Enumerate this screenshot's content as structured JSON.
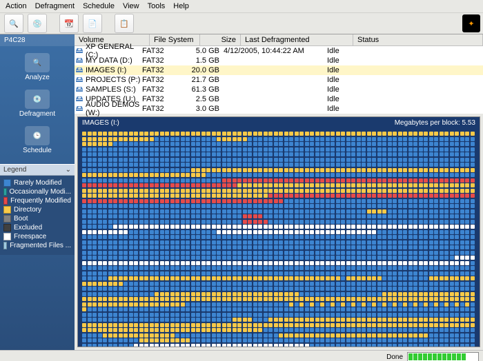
{
  "menu": {
    "items": [
      "Action",
      "Defragment",
      "Schedule",
      "View",
      "Tools",
      "Help"
    ]
  },
  "sidebar": {
    "title": "P4C28",
    "actions": [
      {
        "label": "Analyze"
      },
      {
        "label": "Defragment"
      },
      {
        "label": "Schedule"
      }
    ]
  },
  "legend": {
    "title": "Legend",
    "items": [
      {
        "label": "Rarely Modified",
        "color": "#3d85d1"
      },
      {
        "label": "Occasionally Modi...",
        "color": "#2aa0a0"
      },
      {
        "label": "Frequently Modified",
        "color": "#e54b4b"
      },
      {
        "label": "Directory",
        "color": "#f7c948"
      },
      {
        "label": "Boot",
        "color": "#808080"
      },
      {
        "label": "Excluded",
        "color": "#404040"
      },
      {
        "label": "Freespace",
        "color": "#ffffff"
      },
      {
        "label": "Fragmented Files ...",
        "color": "#9ecae1"
      }
    ]
  },
  "volume_columns": {
    "name": "Volume",
    "fs": "File System",
    "size": "Size",
    "last": "Last Defragmented",
    "status": "Status"
  },
  "volumes": [
    {
      "name": "XP GENERAL (C:)",
      "fs": "FAT32",
      "size": "5.0 GB",
      "last": "4/12/2005, 10:44:22 AM",
      "status": "Idle",
      "sel": false
    },
    {
      "name": "MY DATA (D:)",
      "fs": "FAT32",
      "size": "1.5 GB",
      "last": "",
      "status": "Idle",
      "sel": false
    },
    {
      "name": "IMAGES (I:)",
      "fs": "FAT32",
      "size": "20.0 GB",
      "last": "",
      "status": "Idle",
      "sel": true
    },
    {
      "name": "PROJECTS (P:)",
      "fs": "FAT32",
      "size": "21.7 GB",
      "last": "",
      "status": "Idle",
      "sel": false
    },
    {
      "name": "SAMPLES (S:)",
      "fs": "FAT32",
      "size": "61.3 GB",
      "last": "",
      "status": "Idle",
      "sel": false
    },
    {
      "name": "UPDATES (U:)",
      "fs": "FAT32",
      "size": "2.5 GB",
      "last": "",
      "status": "Idle",
      "sel": false
    },
    {
      "name": "AUDIO DEMOS (W:)",
      "fs": "FAT32",
      "size": "3.0 GB",
      "last": "",
      "status": "Idle",
      "sel": false
    }
  ],
  "map": {
    "title": "IMAGES (I:)",
    "block_info": "Megabytes per block: 5.53",
    "rows": [
      "yyyyyyyyyyyyyyyyyyyyyyyyyyyyyyyyyyyyyyyyyyyyyyyyyyyyyyyyyyyyyyyyyyyyyyyyyyyyyyy",
      "yyyyyyyyyyybbbbbbbbbbbbyyyyyybbbbbbbbbbbbbbbbbbbbbbbbbbbbbbbbbbbbbbbbbbbbyyyyyy",
      "bbbbbbbbbbbbbbbbbbbbbbbbbbbbbbbbbbbbbbbbbbbbbbbbbbbbbbbbbbbbbbbbbbbbbbbbbbbbbbb",
      "bbbbbbbbbbbbbbbbbbbbbbbbbbbbbbbbbbbbbbbbbbbbbbbbbbbbbbbbbbbbbbbbbbbbbbbbbbbbbbb",
      "bbbbbbbbbbbbbbbbbbbbbbbbbbbbbbbbbbbbbbbbbbbbbbbbbbbbbbbbbbbbbbbbbbbbbbbbbbbbbbb",
      "bbbbbbbbbbbbbbbbbbbbbbbbbbbbbbbbbbbbbbbbbbbbbbbbbbbbbbbbbbbbbbbbbbbbbbbbbbbbbbb",
      "bbbbbbbbbbbbbbbbbbbbbbbbbbbbbbbbbbbbbbbbbbbbbbbbbbbbbbbbbbbbbbbbbbbbbbbbbbbbbbb",
      "yyyyyyyyyyyyyyyyyyyyyyyyyyyyyyyyyyyyyyyyyyyyyyyyyyyyyyyyyyyyyyyyyyyyyyyyyyyyyyy",
      "bbbbbbbbbbbbbbbbbbbbbbbbbbbbbbbbbbbbbbbbbbbbbbbbbbbbbbbbbbbbbbbbbbbbbbbbbbbbbbb",
      "rrrrrrrrrrrrrrrrrrrrrrrrrrrrrrrrrrrrrrrrrrrrrrrrrrrrrrrrrrrrrrrrrrrrrrrrrrrrrrr",
      "yyyyyyyyyyyyyyyyyyyyyyyyyyyyyyyyyyyyyyyyyyyyyyyyyyyyyyyyyyyyyyyyyyyyyyyyyyyyyyy",
      "yyyyyyyyyyyyyyyyyyyyyyyyyyyyyyyyyyyyyyyyyyyyyyyyyyyyyyyyyyyyyyyyyyyyyyyyyyyyyyy",
      "rrrrrrrrrrrrrrrrrrrrrrrrrrrrrrrrrrrrrrrrrrrrrrrrrrrrrrrrrrrrrrrrrrrrrrrrrrrrrrr",
      "bbbbbbbbbbbbbbbbbbbbbbbbbbbbbbbbbbbbbbbbbbbbbbbbbbbbbbbbbbbbbbbbbbbbbbbbbbbbbbb",
      "bbbbbbbbbbbbbbbbbbbbbbbbbbbbbbbbbbbbbbbbbbbbbbbbbbbbbbbbbbbbbbbbbbbbbbbbbbbbbbb",
      "bbbbbbbbbbyyyybbbbbbbbbbbbbbbbbbbbbbbbbbbbbbbbbbbbbbbbbbbbbbbbrrrrbbbbbbbbbbbbb",
      "bbbbbbbbbbbbbbbbbbbbbbbbbbbbbbbbbbbbbbbbbbbbbbbbbbbbbbbbbbbrrrrrbbbbbbbbbbbbbbb",
      "bbbbbbbbbbbbbbbbbbbbbbbbbbbbbbbwwwwwwwwwwwwwwwwwwwwwwwwwwwwwwwwwwwwwwwwwwwwwwww",
      "wwwwwwwwwwwwwwwwwwwwwwwwwwwwwwwbbbbbbbbbbbbbbbbbwwwwwwwwwwwwwwwwwwwwwwwwwwwwwww",
      "bbbbbbbbbbbbbbbbbbbbbbbbbbbbbbbbbbbbbbbbbbbbbbbbbbbbbbbbbbbbbbbbbbbbbbbbbbbbbbb",
      "bbbbbbbbbbbbbbbbbbbbbbbbbbbbbbbbbbbbbbbbbbbbbbbbbbbbbbbbbbbbbbbbbbbbbbbbbbbbbbb",
      "bbbbbbbbbbbbbbbbbbbbbbbbbbbbbbbbbbbbbbbbbbbbbbbbbbbbbbbbbbbbbbbbbbbbbbbbbbbbbbb",
      "bbbbbbbbbbbbbbbbbbbbbbbbbbbbbbbbbbbbbbbbbbbbbbbbbbbbbbbbbbbbbbbbbbbbbbbbbbbbbbb",
      "bbbbbbbbbbbbbbbbbbbbbbbbbbbbbbbbbbbbbbbbbbbbbbbbbbbbbbbbbbbbbbbbbbbbbbbbbbbbbbb",
      "wwwwwwwwwwwwwwwwwwwwwwwwwwwwwwwwwwwwwwwwwwwwwwwwwwwwwwwwwwwwwwwwwwwwwwwwwwwwwww",
      "bbbbbbbbbbbbbbbbbbbbbbbbbbbbbbbbbbbbbbbbbbbbbbbbbbbbbbbbbbbbbbbbbbbbbbbbbbbbbbb",
      "bbbbbbbbbbbbbbbbbbbbbbbbbbbbbbbbbbbbbbbbbbbbbbbbbbbbbbbbbbbbbbbbbbbbbbbbbbbbbbb",
      "yyyyyyyyyyyyyyyyyyyyyyyyyyyyyyyyyyyyyyyyyyyyybyyyyyyybbbbbbbbbyyyyyyyyyyyyyyyyy",
      "bbbbbbbbbbbbbbbbbbbbbbbbbbbbbbbbbbbbbbbbbbbbbbbbbbbbbbbbbbbbbbbbbbbbbbbbbbbbbbb",
      "bbbbbbbbbbbbbbbbbbbbbbbbbbbbbbbbbbbbbbbbbbbbbbbbbbbbbbbbbbbbbbbbbbbbbbbbbbbbbbb",
      "yyyyyyyyyyyyyyyyyyyyyyyyyyyybbbbbbbbbbbbbbbbyyyyyyyyyyyyyyyyyyyyyyyyyyyyyyyyyyy",
      "yyyyyyyyyyyyyyyyyyyyyyyyyyyyyyyyyyyyyyyyyyyyyyyyyyyyyyyyyyyyyyyyyyyyyyyyyyyyyyy",
      "bbbbbbbbbbbbbbbbbbbbybybybybybybybybybybybybybybybybybybybbbbbbbbbbbbbbbbbbbbbb",
      "bbbbbbbbbbbbbbbbbbbbbbbbbbbbbbbbbbbbbbbbbbbbbbbbbbbbbbbbbbbbbbbbbbbbbbbbbbbbbbb",
      "bbbbbbbbbbbbbbbbbbbbbbbbbbbbbbbbbbbbbbbbbbbbbbbbbbbbbbbbbbbbbbbbbbbbbbbbbbbbbbb",
      "yyyyubbyyyyyyyyyyyyyyyyyyyyyyyyyyyyyyyyyyyyyyyyyyyyyyyyyyyyyyyyyyyyyyyyyyyyyyyy",
      "yyyyyyyyyyyyyyyyyyyyyyyyyyyyyyyyyyyyyyyyyyyyyyyyyyyyyyyyyyyyyyyyyyyyyyyyyyyyyyy",
      "bbbbbbbbbbbbbbbbbbbbbbbbbbbbbbbbbbbbbbbbbbbbbyyyyyyyyyyyyyybbbbbbbbbbbbbbbbbbbb",
      "yyyyyyyyyyyyyyyyyyyyyyyyyyyyybbbbbbbbbbbbbbbbbbbbyyyyyyyyyybbbbbbbbbbbbbbbbbbbb",
      "bbbbbbbbbbbbbbbbbbbbbbbbbbbbbbbbbbbbbbbbbbbbbwwwwwwwwwwwwwwwwwwwwwwwwwwwwwwwwww",
      "bbbbbbbbbbbbbbbbbbbbbbbbbbbbbbbbbbbbbbbbbbbbbbbbbbbbbbbbbbbbbbbbbbbbbbbbbbbbbbb"
    ]
  },
  "status": {
    "label": "Done"
  }
}
